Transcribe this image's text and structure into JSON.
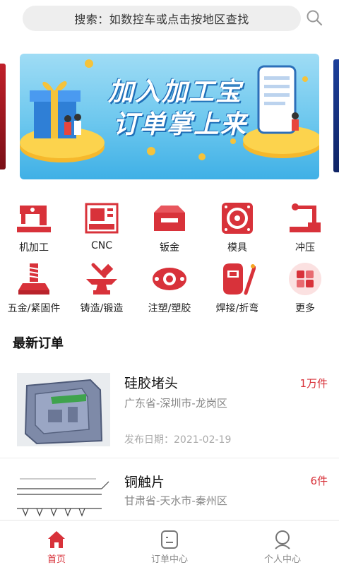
{
  "search": {
    "placeholder": "搜索：如数控车或点击按地区查找"
  },
  "banner": {
    "line1": "加入加工宝",
    "line2": "订单掌上来"
  },
  "categories": [
    {
      "label": "机加工",
      "icon": "sewing-machine-icon"
    },
    {
      "label": "CNC",
      "icon": "cnc-machine-icon"
    },
    {
      "label": "钣金",
      "icon": "sheet-metal-icon"
    },
    {
      "label": "模具",
      "icon": "mold-icon"
    },
    {
      "label": "冲压",
      "icon": "press-icon"
    },
    {
      "label": "五金/紧固件",
      "icon": "bolt-icon"
    },
    {
      "label": "铸造/锻造",
      "icon": "anvil-icon"
    },
    {
      "label": "注塑/塑胶",
      "icon": "gasket-icon"
    },
    {
      "label": "焊接/折弯",
      "icon": "welding-icon"
    },
    {
      "label": "更多",
      "icon": "more-icon"
    }
  ],
  "section": {
    "title": "最新订单"
  },
  "orders": [
    {
      "title": "硅胶堵头",
      "qty": "1万件",
      "location": "广东省-深圳市-龙岗区",
      "date": "发布日期：2021-02-19",
      "image_label": "cad-model"
    },
    {
      "title": "铜触片",
      "qty": "6件",
      "location": "甘肃省-天水市-秦州区",
      "image_label": "technical-drawing"
    }
  ],
  "tabs": [
    {
      "label": "首页",
      "icon": "home-icon",
      "active": true
    },
    {
      "label": "订单中心",
      "icon": "order-icon",
      "active": false
    },
    {
      "label": "个人中心",
      "icon": "user-icon",
      "active": false
    }
  ],
  "colors": {
    "accent": "#d8323a",
    "icon_red": "#d8323a",
    "banner_blue": "#6cc7ee"
  }
}
